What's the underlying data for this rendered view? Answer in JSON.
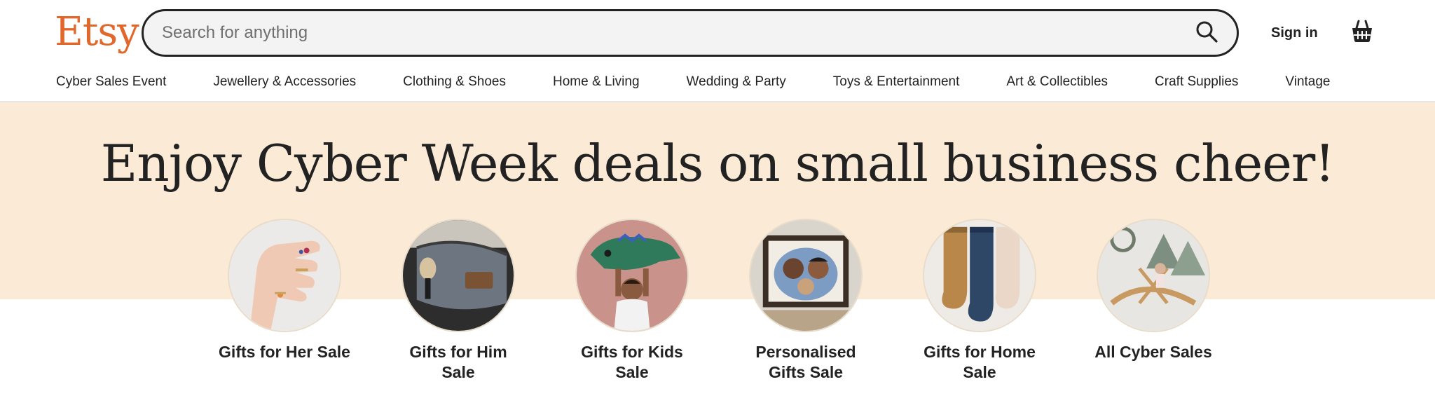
{
  "header": {
    "logo": "Etsy",
    "search_placeholder": "Search for anything",
    "search_value": "",
    "signin_label": "Sign in"
  },
  "nav": {
    "items": [
      "Cyber Sales Event",
      "Jewellery & Accessories",
      "Clothing & Shoes",
      "Home & Living",
      "Wedding & Party",
      "Toys & Entertainment",
      "Art & Collectibles",
      "Craft Supplies",
      "Vintage"
    ]
  },
  "hero": {
    "title": "Enjoy Cyber Week deals on small business cheer!",
    "categories": [
      {
        "label": "Gifts for Her Sale",
        "image": "hand-with-rings"
      },
      {
        "label": "Gifts for Him Sale",
        "image": "grey-toiletry-bag"
      },
      {
        "label": "Gifts for Kids Sale",
        "image": "child-with-dinosaur-toy"
      },
      {
        "label": "Personalised Gifts Sale",
        "image": "family-portrait-illustration"
      },
      {
        "label": "Gifts for Home Sale",
        "image": "christmas-stockings"
      },
      {
        "label": "All Cyber Sales",
        "image": "wooden-play-furniture"
      }
    ]
  },
  "colors": {
    "brand": "#e2672b",
    "hero_background": "#fbebd6",
    "text": "#222222"
  },
  "icons": {
    "search": "search-icon",
    "cart": "shopping-basket-icon"
  }
}
